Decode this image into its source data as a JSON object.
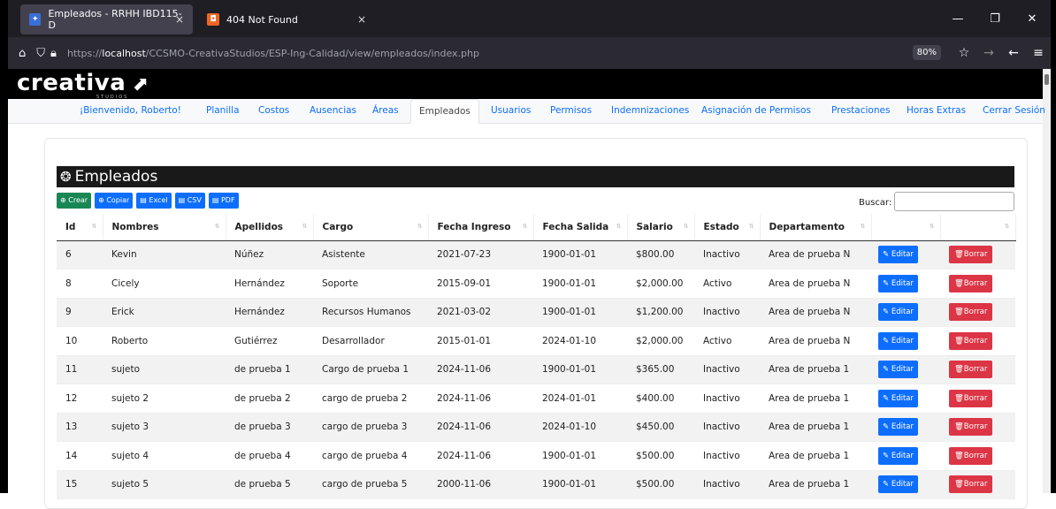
{
  "browser": {
    "tabs": [
      {
        "title": "Empleados - RRHH IBD115-D"
      },
      {
        "title": "404 Not Found"
      }
    ],
    "close_glyph": "×",
    "url_prefix": "https://",
    "url_host": "localhost",
    "url_path": "/CCSMO-CreativaStudios/ESP-Ing-Calidad/view/empleados/index.php",
    "zoom": "80%"
  },
  "brand": {
    "name": "creativa",
    "tagline": "STUDIOS"
  },
  "menu": {
    "items": [
      {
        "label": "¡Bienvenido, Roberto!"
      },
      {
        "label": "Planilla"
      },
      {
        "label": "Costos"
      },
      {
        "label": "Ausencias"
      },
      {
        "label": "Áreas"
      },
      {
        "label": "Empleados"
      },
      {
        "label": "Usuarios"
      },
      {
        "label": "Permisos"
      },
      {
        "label": "Indemnizaciones"
      },
      {
        "label": "Asignación de Permisos"
      },
      {
        "label": "Prestaciones"
      },
      {
        "label": "Horas Extras"
      },
      {
        "label": "Cerrar Sesión"
      }
    ],
    "active": "Empleados"
  },
  "page": {
    "title": "Empleados",
    "search_label": "Buscar:",
    "buttons": {
      "create": "Crear",
      "copy": "Copiar",
      "excel": "Excel",
      "csv": "CSV",
      "pdf": "PDF"
    }
  },
  "table": {
    "headers": [
      "Id",
      "Nombres",
      "Apellidos",
      "Cargo",
      "Fecha Ingreso",
      "Fecha Salida",
      "Salario",
      "Estado",
      "Departamento",
      "",
      ""
    ],
    "edit_label": "Editar",
    "delete_label": "Borrar",
    "rows": [
      [
        "6",
        "Kevin",
        "Núñez",
        "Asistente",
        "2021-07-23",
        "1900-01-01",
        "$800.00",
        "Inactivo",
        "Area de prueba N"
      ],
      [
        "8",
        "Cicely",
        "Hernández",
        "Soporte",
        "2015-09-01",
        "1900-01-01",
        "$2,000.00",
        "Activo",
        "Area de prueba N"
      ],
      [
        "9",
        "Erick",
        "Hernández",
        "Recursos Humanos",
        "2021-03-02",
        "1900-01-01",
        "$1,200.00",
        "Inactivo",
        "Area de prueba N"
      ],
      [
        "10",
        "Roberto",
        "Gutiérrez",
        "Desarrollador",
        "2015-01-01",
        "2024-01-10",
        "$2,000.00",
        "Activo",
        "Area de prueba N"
      ],
      [
        "11",
        "sujeto",
        "de prueba 1",
        "Cargo de prueba 1",
        "2024-11-06",
        "1900-01-01",
        "$365.00",
        "Inactivo",
        "Area de prueba 1"
      ],
      [
        "12",
        "sujeto 2",
        "de prueba 2",
        "cargo de prueba 2",
        "2024-11-06",
        "2024-01-01",
        "$400.00",
        "Inactivo",
        "Area de prueba 1"
      ],
      [
        "13",
        "sujeto 3",
        "de prueba 3",
        "cargo de prueba 3",
        "2024-11-06",
        "2024-01-10",
        "$450.00",
        "Inactivo",
        "Area de prueba 1"
      ],
      [
        "14",
        "sujeto 4",
        "de prueba 4",
        "cargo de prueba 4",
        "2024-11-06",
        "1900-01-01",
        "$500.00",
        "Inactivo",
        "Area de prueba 1"
      ],
      [
        "15",
        "sujeto 5",
        "de prueba 5",
        "cargo de prueba 5",
        "2000-11-06",
        "1900-01-01",
        "$500.00",
        "Inactivo",
        "Area de prueba 1"
      ]
    ]
  },
  "colors": {
    "primary": "#0d6efd",
    "success": "#198754",
    "danger": "#dc3545",
    "header_bg": "#191919"
  }
}
